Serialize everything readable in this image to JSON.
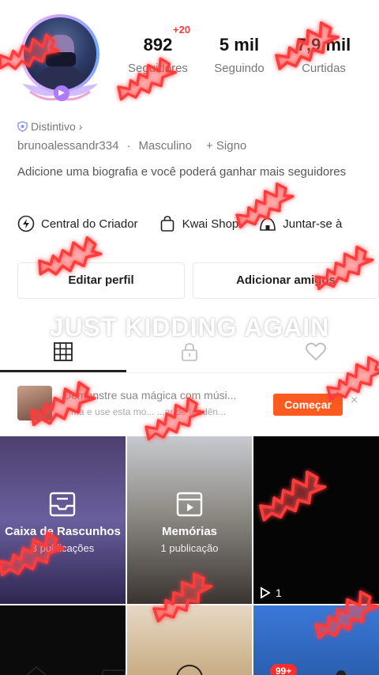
{
  "profile": {
    "stats": [
      {
        "value": "892",
        "label": "Seguidores",
        "badge": "+20"
      },
      {
        "value": "5 mil",
        "label": "Seguindo"
      },
      {
        "value": "7,9 mil",
        "label": "Curtidas"
      }
    ],
    "distintivo": "Distintivo",
    "username": "brunoalessandr334",
    "gender": "Masculino",
    "sign": "+ Signo",
    "bio": "Adicione uma biografia e você poderá ganhar mais seguidores"
  },
  "shortcuts": [
    {
      "label": "Central do Criador",
      "icon": "lightning-icon"
    },
    {
      "label": "Kwai Shop",
      "icon": "bag-icon"
    },
    {
      "label": "Juntar-se à",
      "icon": "tent-icon"
    }
  ],
  "buttons": {
    "edit": "Editar perfil",
    "add": "Adicionar amigos"
  },
  "overlay": "JUST KIDDING AGAIN",
  "tabs": [
    {
      "icon": "grid-icon",
      "selected": true
    },
    {
      "icon": "lock-icon",
      "selected": false
    },
    {
      "icon": "heart-icon",
      "selected": false
    }
  ],
  "promo": {
    "title": "Demonstre sua mágica com músi...",
    "subtitle": "...ma e use esta mo... ...ar de tendên...",
    "cta": "Começar",
    "close": "×"
  },
  "grid": {
    "drafts": {
      "label": "Caixa de Rascunhos",
      "sub": "3 publicações"
    },
    "memories": {
      "label": "Memórias",
      "sub": "1 publicação"
    },
    "video": {
      "plays": "1"
    }
  },
  "notifications": {
    "count": "99+"
  },
  "colors": {
    "accent": "#ff5a1f",
    "badge": "#ff2d2d",
    "bat": "#ff3b3b"
  }
}
